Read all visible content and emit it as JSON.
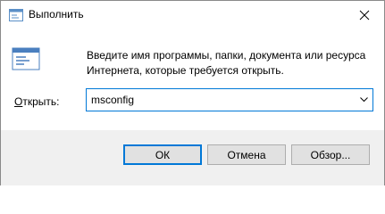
{
  "window": {
    "title": "Выполнить",
    "close_icon": "close-icon",
    "app_icon": "run-dialog-icon"
  },
  "body": {
    "description": "Введите имя программы, папки, документа или ресурса Интернета, которые требуется открыть.",
    "open_label_accel": "О",
    "open_label_rest": "ткрыть:",
    "input_value": "msconfig",
    "dropdown_icon": "chevron-down-icon"
  },
  "buttons": {
    "ok": "ОК",
    "cancel": "Отмена",
    "browse": "Обзор..."
  },
  "colors": {
    "accent": "#0078d7",
    "footer_bg": "#f0f0f0",
    "button_bg": "#e1e1e1"
  }
}
